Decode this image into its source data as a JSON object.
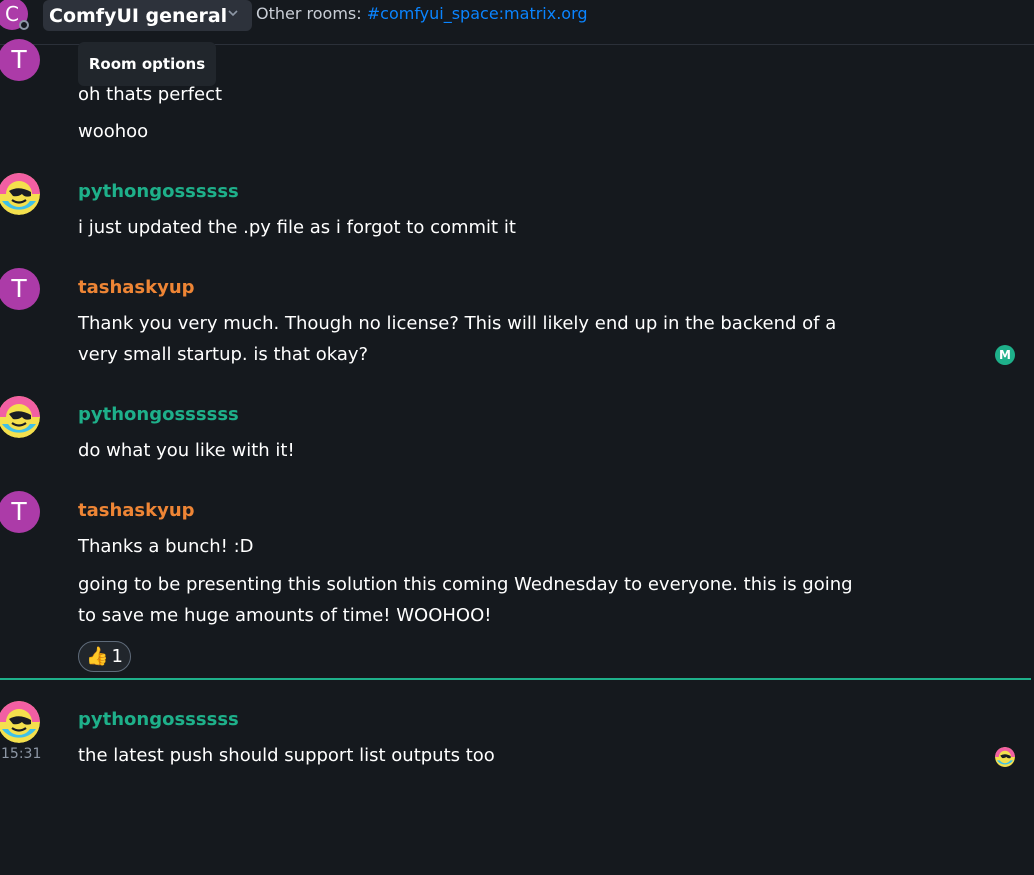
{
  "room": {
    "avatar_letter": "C",
    "name": "ComfyUI general",
    "other_rooms_label": "Other rooms:",
    "other_rooms_link": "#comfyui_space:matrix.org"
  },
  "tooltip": "Room options",
  "messages": [
    {
      "avatar": "T",
      "lines": [
        "oh thats perfect",
        "woohoo"
      ]
    },
    {
      "sender": "pythongossssss",
      "lines": [
        "i just updated the .py file as i forgot to commit it"
      ]
    },
    {
      "avatar": "T",
      "sender": "tashaskyup",
      "lines": [
        "Thank you very much. Though no license? This will likely end up in the backend of a",
        "very small startup. is that okay?"
      ]
    },
    {
      "sender": "pythongossssss",
      "lines": [
        "do what you like with it!"
      ]
    },
    {
      "avatar": "T",
      "sender": "tashaskyup",
      "lines": [
        "Thanks a bunch! :D",
        "going to be presenting this solution this coming Wednesday to everyone. this is going",
        "to save me huge amounts of time! WOOHOO!"
      ],
      "reaction": {
        "emoji": "👍",
        "count": "1"
      }
    },
    {
      "sender": "pythongossssss",
      "timestamp": "15:31",
      "lines": [
        "the latest push should support list outputs too"
      ]
    }
  ],
  "read_receipts": [
    {
      "letter": "M"
    }
  ],
  "colors": {
    "sender_green": "#1eb08a",
    "sender_orange": "#ee8535",
    "avatar_purple": "#ac3ba8",
    "link": "#0a84ff"
  }
}
